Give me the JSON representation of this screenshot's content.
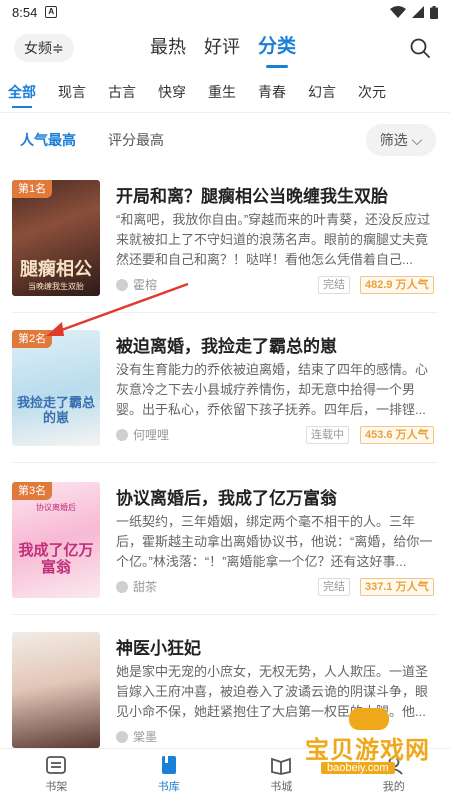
{
  "status_bar": {
    "time": "8:54",
    "app_badge": "A"
  },
  "header": {
    "gender_toggle": "女频≑",
    "tabs": [
      {
        "label": "最热",
        "active": false
      },
      {
        "label": "好评",
        "active": false
      },
      {
        "label": "分类",
        "active": true
      }
    ]
  },
  "categories": [
    "全部",
    "现言",
    "古言",
    "快穿",
    "重生",
    "青春",
    "幻言",
    "次元"
  ],
  "sort": {
    "popular": "人气最高",
    "rating": "评分最高",
    "filter": "筛选 ⌵"
  },
  "books": [
    {
      "rank": "第1名",
      "cover_title": "腿瘸相公",
      "cover_sub": "当晚缠我生双胎",
      "title": "开局和离？腿瘸相公当晚缠我生双胎",
      "desc": "“和离吧，我放你自由。”穿越而来的叶青葵，还没反应过来就被扣上了不守妇道的浪荡名声。眼前的瘸腿丈夫竟然还要和自己和离？！哒咩！看他怎么凭借着自己...",
      "author": "霍榕",
      "status": "完结",
      "popularity": "482.9 万人气"
    },
    {
      "rank": "第2名",
      "cover_title": "我捡走了霸总的崽",
      "cover_sub": "",
      "title": "被迫离婚，我捡走了霸总的崽",
      "desc": "没有生育能力的乔依被迫离婚，结束了四年的感情。心灰意冷之下去小县城疗养情伤，却无意中拾得一个男婴。出于私心，乔依留下孩子抚养。四年后，一排铿...",
      "author": "何哩哩",
      "status": "连载中",
      "popularity": "453.6 万人气"
    },
    {
      "rank": "第3名",
      "cover_title": "我成了亿万富翁",
      "cover_sub": "协议离婚后",
      "title": "协议离婚后，我成了亿万富翁",
      "desc": "一纸契约，三年婚姻，绑定两个毫不相干的人。三年后，霍斯越主动拿出离婚协议书，他说：“离婚，给你一个亿。”林浅落：“！”离婚能拿一个亿？还有这好事...",
      "author": "甜茶",
      "status": "完结",
      "popularity": "337.1 万人气"
    },
    {
      "rank": "",
      "cover_title": "",
      "cover_sub": "",
      "title": "神医小狂妃",
      "desc": "她是家中无宠的小庶女，无权无势，人人欺压。一道圣旨嫁入王府冲喜，被迫卷入了波谲云诡的阴谋斗争，眼见小命不保，她赶紧抱住了大启第一权臣的大腿。他...",
      "author": "棠墨",
      "status": "",
      "popularity": ""
    }
  ],
  "bottom_nav": [
    {
      "label": "书架",
      "icon": "bookshelf-icon",
      "active": false
    },
    {
      "label": "书库",
      "icon": "library-icon",
      "active": true
    },
    {
      "label": "书城",
      "icon": "bookstore-icon",
      "active": false
    },
    {
      "label": "我的",
      "icon": "profile-icon",
      "active": false
    }
  ],
  "watermark": {
    "text": "宝贝游戏网",
    "url": "baobeiy.com"
  },
  "colors": {
    "accent": "#1a7fd6",
    "badge": "#e07a3a",
    "popularity": "#e9a23b"
  }
}
